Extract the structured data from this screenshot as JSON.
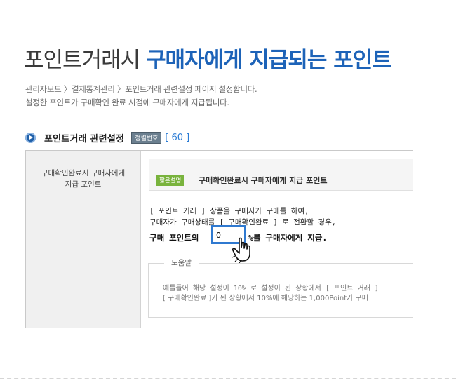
{
  "header": {
    "title_plain": "포인트거래시",
    "title_accent": "구매자에게 지급되는 포인트",
    "breadcrumb": "관리자모드 〉결제통계관리 〉포인트거래 관련설정 페이지 설정합니다.",
    "description": "설정한 포인트가 구매확인 완료 시점에 구매자에게 지급됩니다."
  },
  "section": {
    "heading": "포인트거래 관련설정",
    "badge": "정렬번호",
    "number": "[ 60 ]"
  },
  "form": {
    "left_label_1": "구매확인완료시 구매자에게",
    "left_label_2": "지급 포인트",
    "info_tag": "짧은설명",
    "info_text": "구매확인완료시 구매자에게 지급 포인트",
    "line1": "[ 포인트 거래 ] 상품을 구매자가 구매를 하여,",
    "line2": "구매자가 구매상태를 [ 구매확인완료 ] 로 전환할 경우,",
    "line3_prefix": "구매 포인트의",
    "point_value": "0",
    "line3_suffix": "%를 구매자에게 지급.",
    "help_legend": "도움말",
    "help_line1": "예를들어 해당 설정이 10% 로 설정이 된 상황에서 [ 포인트 거래 ]",
    "help_line2": "[ 구매확인완료 ]가 된 상황에서 10%에 해당하는 1,000Point가 구매"
  },
  "colors": {
    "accent": "#1d63b8",
    "input_border": "#2f79d0",
    "tag_green": "#79b33d"
  }
}
